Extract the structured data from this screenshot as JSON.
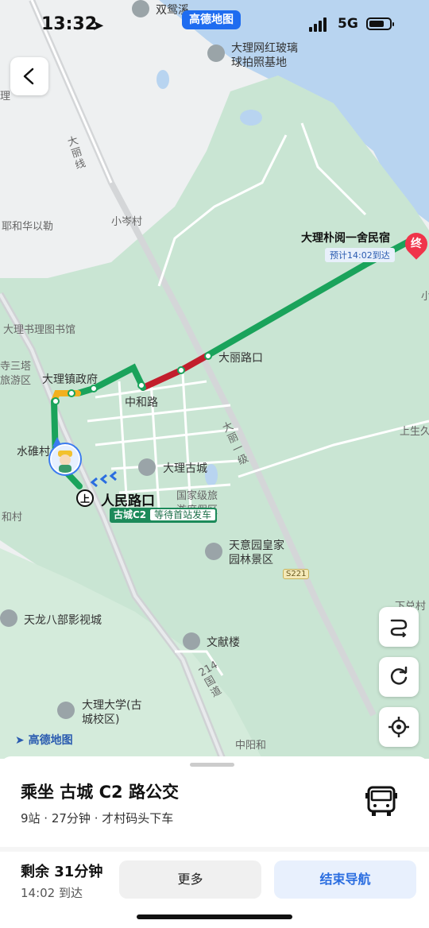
{
  "status_bar": {
    "time": "13:32",
    "app_pill": "高德地图",
    "network": "5G"
  },
  "map": {
    "labels": {
      "shuangyuan": "双鸳溪",
      "glass_a": "大理网红玻璃",
      "glass_b": "球拍照基地",
      "dali_line": "大丽线",
      "yehua": "耶和华以勒",
      "xiaocen": "小岑村",
      "library": "大理书理图书馆",
      "santa_a": "寺三塔",
      "santa_b": "旅游区",
      "town_gov": "大理镇政府",
      "zhonghe": "中和路",
      "dalilu": "大丽路口",
      "shuiwei": "水碓村",
      "ancient_city": "大理古城",
      "heritage_a": "国家级旅",
      "heritage_b": "游度假区",
      "herong": "和村",
      "tianyi_a": "天意园皇家",
      "tianyi_b": "园林景区",
      "tianlong": "天龙八部影视城",
      "wenxian": "文献楼",
      "univ_a": "大理大学(古",
      "univ_b": "城校区)",
      "road214": "214国道",
      "zhongyang": "中阳和",
      "daliyiji": "大丽一级",
      "shangsheng": "上生久",
      "xiaduan": "下兑村",
      "edge_li": "理",
      "edge_xiao": "小"
    },
    "road_tag": "S221",
    "destination": {
      "name": "大理朴阅一舍民宿",
      "eta": "预计14:02到达",
      "end_badge": "终"
    },
    "boarding": {
      "badge": "上",
      "stop": "人民路口",
      "line": "古城C2",
      "wait": "等待首站发车"
    },
    "watermark": "高德地图"
  },
  "sheet": {
    "title": "乘坐 古城 C2 路公交",
    "subtitle": "9站 · 27分钟 · 才村码头下车",
    "remaining": "剩余 31分钟",
    "arrival": "14:02 到达",
    "more_label": "更多",
    "end_nav_label": "结束导航"
  },
  "colors": {
    "route_green": "#1aa35b",
    "congestion_red": "#c21e2c",
    "slow_yellow": "#f2b01e",
    "water": "#b8d4f0",
    "land": "#c9e5d3",
    "accent_blue": "#2a6de0"
  }
}
